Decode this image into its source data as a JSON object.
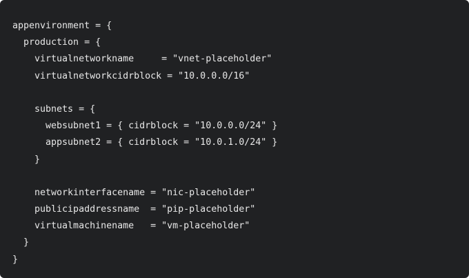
{
  "code": {
    "language": "hcl",
    "lines": [
      "appenvironment = {",
      "  production = {",
      "    virtualnetworkname     = \"vnet-placeholder\"",
      "    virtualnetworkcidrblock = \"10.0.0.0/16\"",
      "",
      "    subnets = {",
      "      websubnet1 = { cidrblock = \"10.0.0.0/24\" }",
      "      appsubnet2 = { cidrblock = \"10.0.1.0/24\" }",
      "    }",
      "",
      "    networkinterfacename = \"nic-placeholder\"",
      "    publicipaddressname  = \"pip-placeholder\"",
      "    virtualmachinename   = \"vm-placeholder\"",
      "  }",
      "}"
    ]
  },
  "colors": {
    "background": "#202123",
    "text": "#e8e8e8"
  }
}
